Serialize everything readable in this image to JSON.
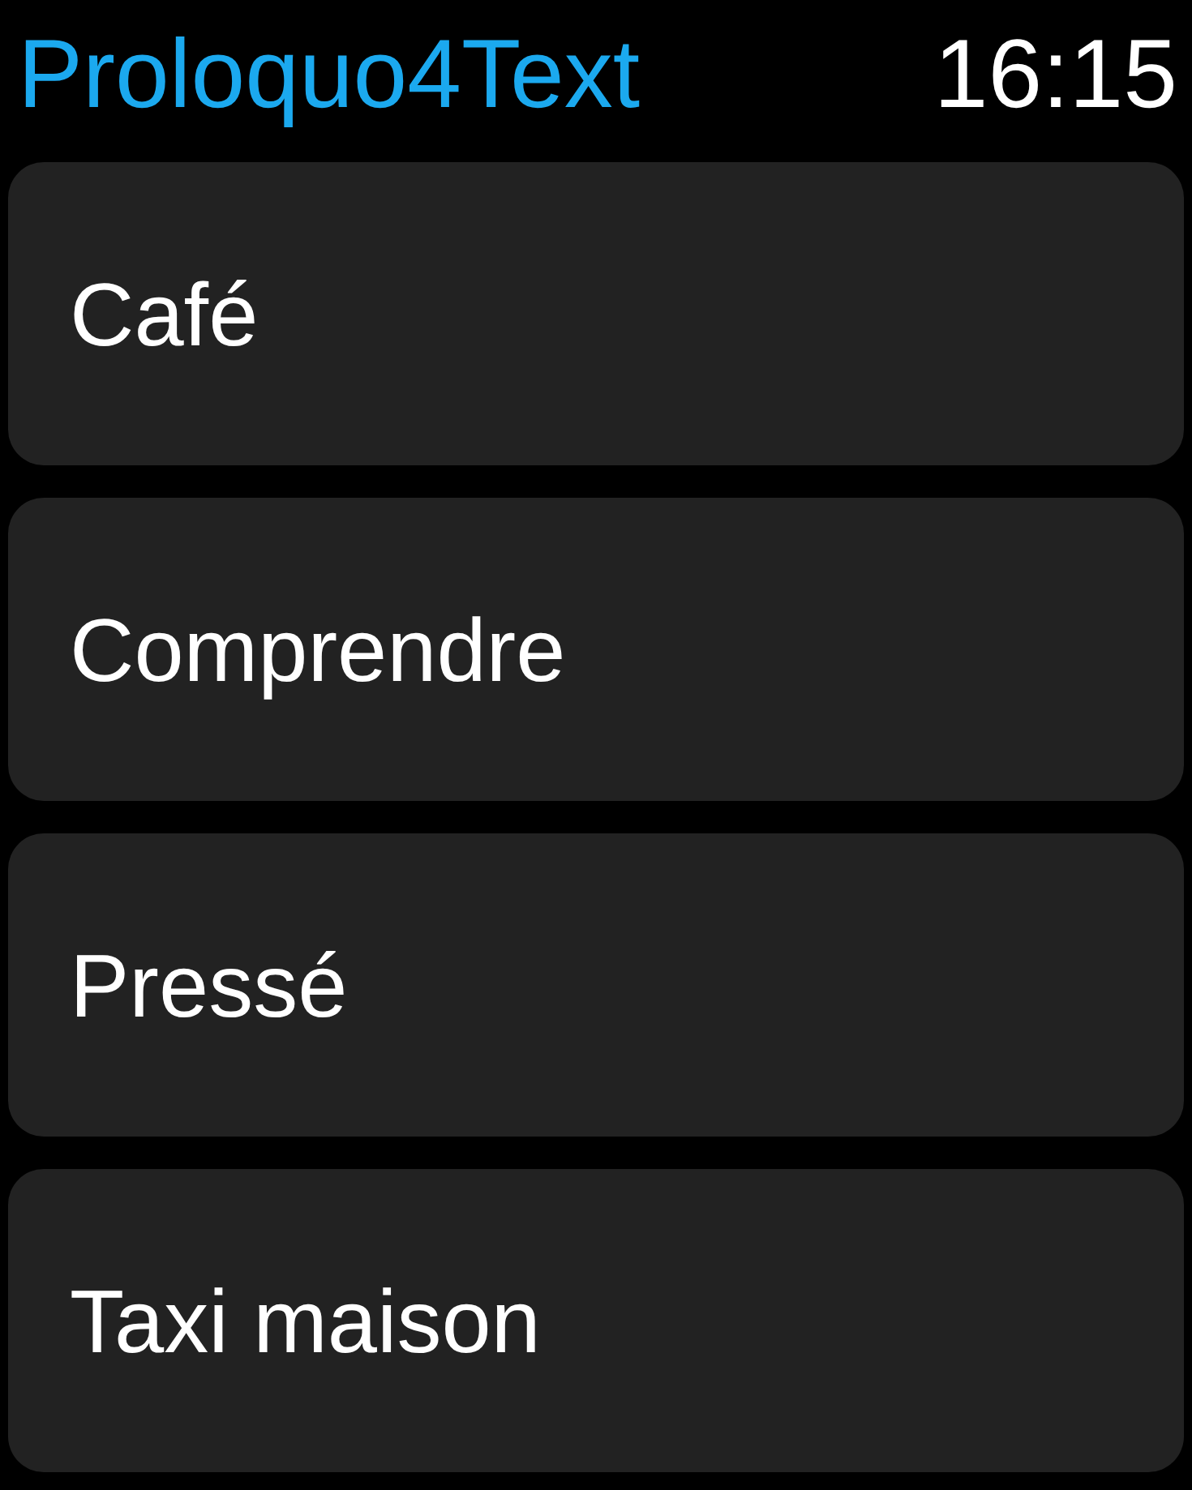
{
  "header": {
    "title": "Proloquo4Text",
    "time": "16:15"
  },
  "phrases": [
    {
      "label": "Café"
    },
    {
      "label": "Comprendre"
    },
    {
      "label": "Pressé"
    },
    {
      "label": "Taxi maison"
    }
  ]
}
